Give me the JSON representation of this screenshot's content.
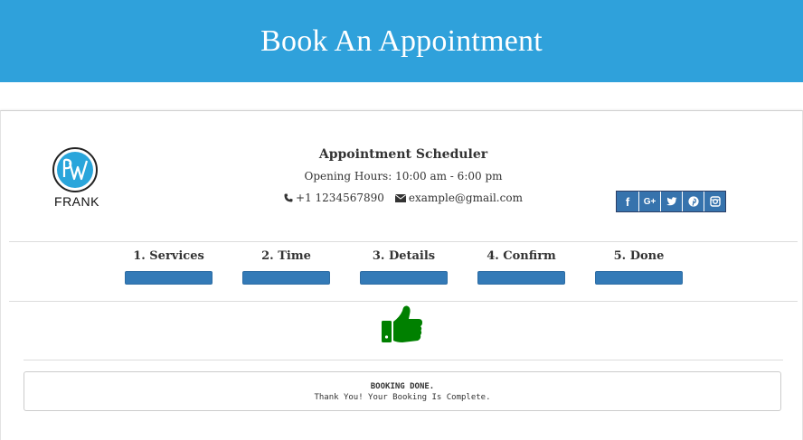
{
  "header": {
    "title": "Book An Appointment"
  },
  "colors": {
    "banner": "#2fa1db",
    "step_bar": "#337ab7",
    "thumb": "#008000",
    "social": "#3673ad"
  },
  "logo": {
    "text": "FRANK",
    "letter": "W",
    "icon": "pw-logo"
  },
  "business": {
    "title": "Appointment Scheduler",
    "hours": "Opening Hours: 10:00 am - 6:00 pm",
    "phone": "+1 1234567890",
    "email": "example@gmail.com"
  },
  "social": [
    {
      "icon": "facebook-icon",
      "glyph": "f"
    },
    {
      "icon": "google-plus-icon",
      "glyph": "G+"
    },
    {
      "icon": "twitter-icon",
      "glyph": ""
    },
    {
      "icon": "pinterest-icon",
      "glyph": ""
    },
    {
      "icon": "instagram-icon",
      "glyph": ""
    }
  ],
  "steps": [
    {
      "label": "1. Services",
      "progress": 1
    },
    {
      "label": "2. Time",
      "progress": 1
    },
    {
      "label": "3. Details",
      "progress": 1
    },
    {
      "label": "4. Confirm",
      "progress": 1
    },
    {
      "label": "5. Done",
      "progress": 1
    }
  ],
  "result": {
    "icon": "thumbs-up-icon",
    "heading": "BOOKING DONE.",
    "message": "Thank You! Your Booking Is Complete."
  }
}
